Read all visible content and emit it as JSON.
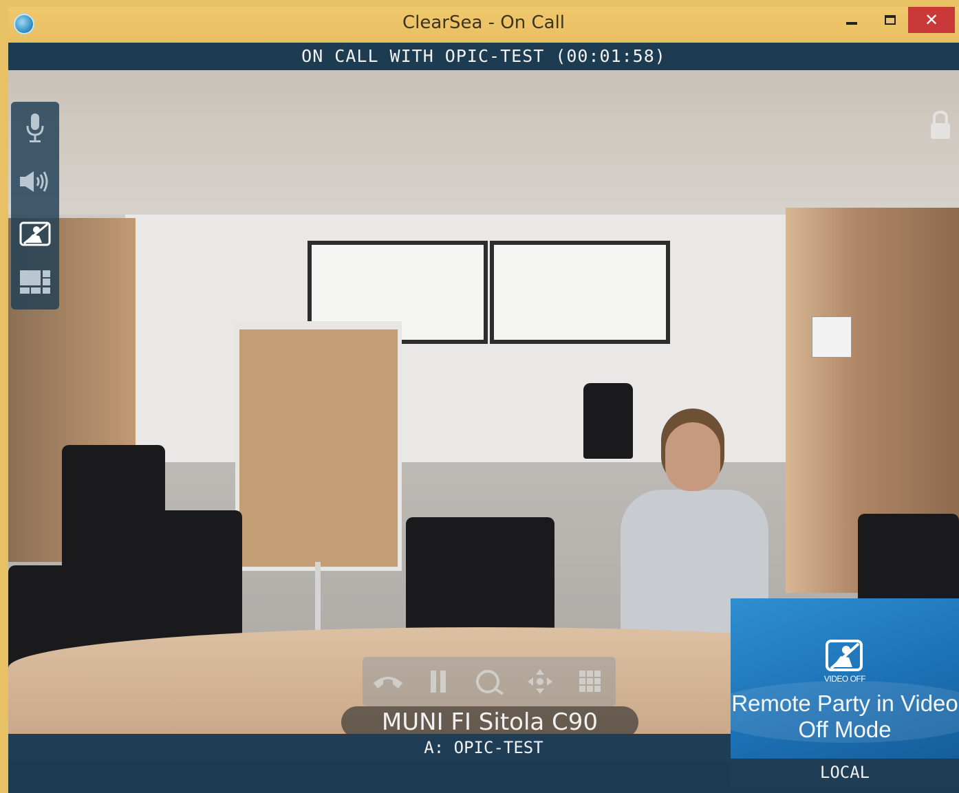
{
  "window": {
    "title": "ClearSea - On Call",
    "controls": {
      "minimize": "minimize-icon",
      "maximize": "maximize-icon",
      "close": "✕"
    }
  },
  "call": {
    "status": "ON CALL WITH OPIC-TEST (00:01:58)",
    "remote_name": "MUNI FI Sitola C90",
    "audio_source": "A: OPIC-TEST"
  },
  "toolbar": {
    "items": [
      {
        "icon": "microphone-icon"
      },
      {
        "icon": "speaker-icon"
      },
      {
        "icon": "video-off-icon"
      },
      {
        "icon": "layout-icon"
      }
    ]
  },
  "call_controls": [
    "hangup-icon",
    "pause-icon",
    "content-share-icon",
    "camera-control-icon",
    "keypad-icon"
  ],
  "local_view": {
    "icon_caption": "VIDEO OFF",
    "message": "Remote Party in Video Off Mode",
    "label": "LOCAL"
  },
  "colors": {
    "title_bar": "#e8be60",
    "panel_bg": "#1f3e55",
    "close_button": "#c9393a",
    "pip_blue": "#1d72b6"
  }
}
